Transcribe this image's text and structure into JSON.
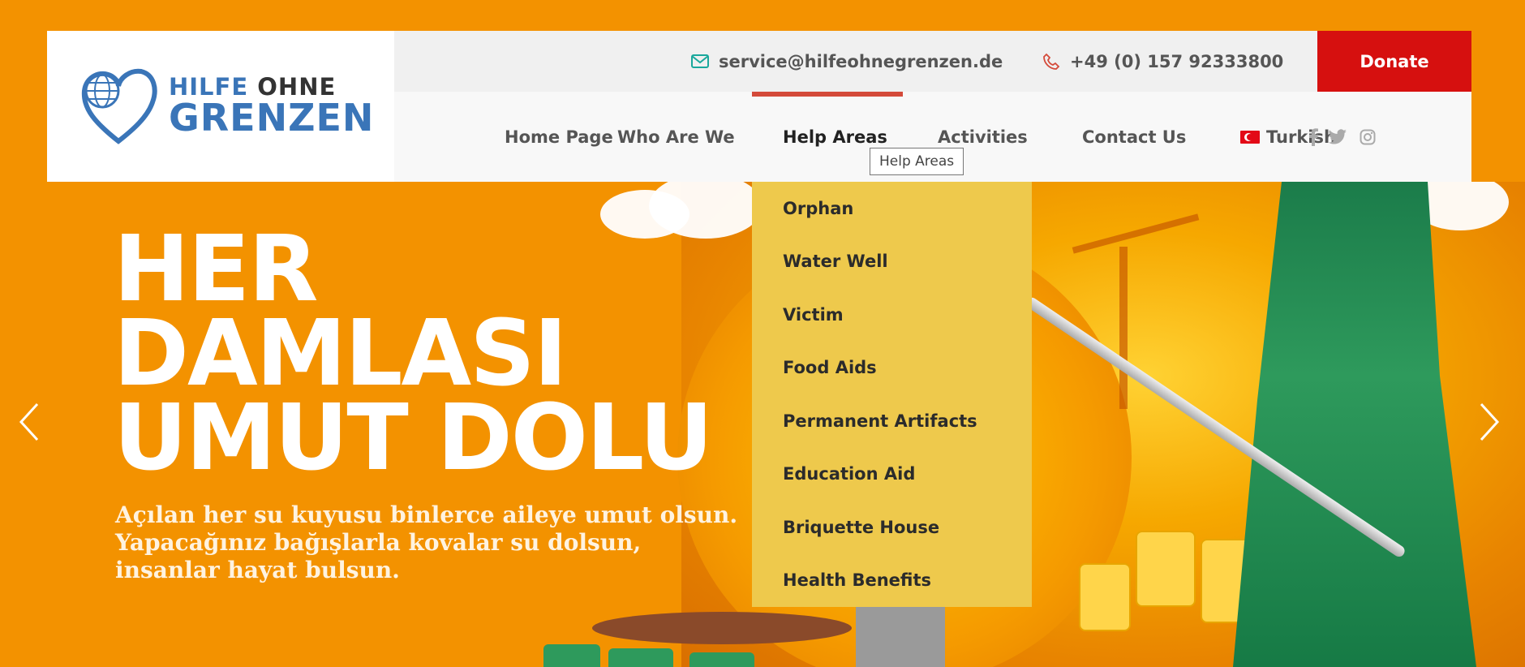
{
  "header": {
    "logo": {
      "line1a": "HILFE",
      "line1b": "OHNE",
      "line2": "GRENZEN"
    },
    "contact": {
      "email": "service@hilfeohnegrenzen.de",
      "phone": "+49 (0) 157 92333800"
    },
    "donate_label": "Donate",
    "nav": [
      {
        "label": "Home Page"
      },
      {
        "label": "Who Are We"
      },
      {
        "label": "Help Areas"
      },
      {
        "label": "Activities"
      },
      {
        "label": "Contact Us"
      },
      {
        "label": "Turkish"
      }
    ],
    "active_nav": "Help Areas",
    "social_icons": [
      "facebook-icon",
      "twitter-icon",
      "instagram-icon"
    ]
  },
  "tooltip": "Help Areas",
  "dropdown": {
    "items": [
      "Orphan",
      "Water Well",
      "Victim",
      "Food Aids",
      "Permanent Artifacts",
      "Education Aid",
      "Briquette House",
      "Health Benefits"
    ]
  },
  "hero": {
    "title_lines": [
      "HER",
      "DAMLASI",
      "UMUT DOLU"
    ],
    "subtitle_lines": [
      "Açılan her su kuyusu binlerce aileye umut olsun.",
      "Yapacağınız bağışlarla kovalar su dolsun,",
      "insanlar hayat bulsun."
    ]
  },
  "colors": {
    "background": "#f39200",
    "brand_blue": "#3a75b8",
    "donate_red": "#d6100f",
    "active_bar": "#d44a3a",
    "dropdown_bg": "#eec94c",
    "email_icon": "#1aa89c",
    "phone_icon": "#d44a3a"
  }
}
